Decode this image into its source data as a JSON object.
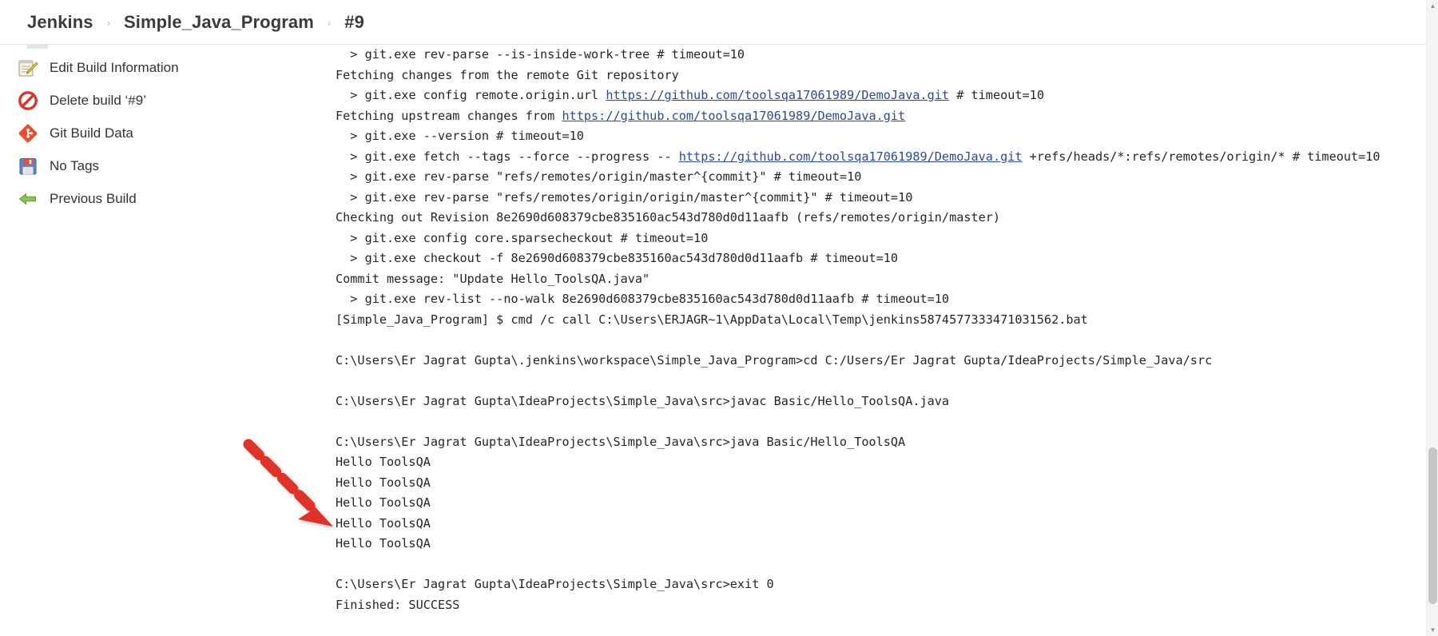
{
  "breadcrumb": {
    "items": [
      "Jenkins",
      "Simple_Java_Program",
      "#9"
    ],
    "separator": "›"
  },
  "sidebar": {
    "items": [
      {
        "label": "Edit Build Information",
        "icon": "edit-notepad-icon"
      },
      {
        "label": "Delete build ‘#9’",
        "icon": "delete-prohibition-icon"
      },
      {
        "label": "Git Build Data",
        "icon": "git-diamond-icon"
      },
      {
        "label": "No Tags",
        "icon": "floppy-disk-icon"
      },
      {
        "label": "Previous Build",
        "icon": "previous-build-arrow-icon"
      }
    ]
  },
  "console": {
    "lines": [
      {
        "text": "  > git.exe rev-parse --is-inside-work-tree # timeout=10"
      },
      {
        "text": "Fetching changes from the remote Git repository"
      },
      {
        "pre": "  > git.exe config remote.origin.url ",
        "link": "https://github.com/toolsqa17061989/DemoJava.git",
        "post": " # timeout=10"
      },
      {
        "pre": "Fetching upstream changes from ",
        "link": "https://github.com/toolsqa17061989/DemoJava.git",
        "post": ""
      },
      {
        "text": "  > git.exe --version # timeout=10"
      },
      {
        "pre": "  > git.exe fetch --tags --force --progress -- ",
        "link": "https://github.com/toolsqa17061989/DemoJava.git",
        "post": " +refs/heads/*:refs/remotes/origin/* # timeout=10"
      },
      {
        "text": "  > git.exe rev-parse \"refs/remotes/origin/master^{commit}\" # timeout=10"
      },
      {
        "text": "  > git.exe rev-parse \"refs/remotes/origin/origin/master^{commit}\" # timeout=10"
      },
      {
        "text": "Checking out Revision 8e2690d608379cbe835160ac543d780d0d11aafb (refs/remotes/origin/master)"
      },
      {
        "text": "  > git.exe config core.sparsecheckout # timeout=10"
      },
      {
        "text": "  > git.exe checkout -f 8e2690d608379cbe835160ac543d780d0d11aafb # timeout=10"
      },
      {
        "text": "Commit message: \"Update Hello_ToolsQA.java\""
      },
      {
        "text": "  > git.exe rev-list --no-walk 8e2690d608379cbe835160ac543d780d0d11aafb # timeout=10"
      },
      {
        "text": "[Simple_Java_Program] $ cmd /c call C:\\Users\\ERJAGR~1\\AppData\\Local\\Temp\\jenkins5874577333471031562.bat"
      },
      {
        "text": ""
      },
      {
        "text": "C:\\Users\\Er Jagrat Gupta\\.jenkins\\workspace\\Simple_Java_Program>cd C:/Users/Er Jagrat Gupta/IdeaProjects/Simple_Java/src"
      },
      {
        "text": ""
      },
      {
        "text": "C:\\Users\\Er Jagrat Gupta\\IdeaProjects\\Simple_Java\\src>javac Basic/Hello_ToolsQA.java"
      },
      {
        "text": ""
      },
      {
        "text": "C:\\Users\\Er Jagrat Gupta\\IdeaProjects\\Simple_Java\\src>java Basic/Hello_ToolsQA"
      },
      {
        "text": "Hello ToolsQA"
      },
      {
        "text": "Hello ToolsQA"
      },
      {
        "text": "Hello ToolsQA"
      },
      {
        "text": "Hello ToolsQA"
      },
      {
        "text": "Hello ToolsQA"
      },
      {
        "text": ""
      },
      {
        "text": "C:\\Users\\Er Jagrat Gupta\\IdeaProjects\\Simple_Java\\src>exit 0"
      },
      {
        "text": "Finished: SUCCESS"
      }
    ]
  },
  "annotation": {
    "type": "dashed-arrow",
    "color": "#e03127",
    "points_to": "Finished: SUCCESS"
  },
  "scrollbar": {
    "up_glyph": "▲",
    "down_glyph": "▼"
  }
}
